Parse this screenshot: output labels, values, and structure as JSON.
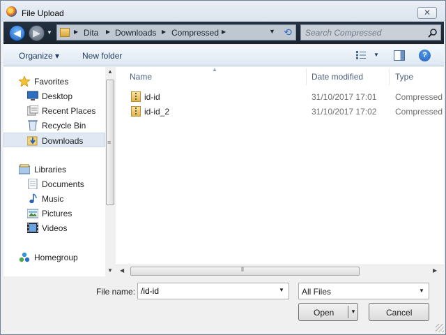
{
  "window": {
    "title": "File Upload",
    "close_glyph": "✕"
  },
  "address": {
    "back_glyph": "◀",
    "forward_glyph": "▶",
    "crumbs": [
      "Dita",
      "Downloads",
      "Compressed"
    ],
    "search_placeholder": "Search Compressed"
  },
  "toolbar": {
    "organize": "Organize ▾",
    "new_folder": "New folder",
    "help_glyph": "?"
  },
  "sidebar": {
    "items": [
      {
        "label": "Favorites",
        "icon": "star-icon"
      },
      {
        "label": "Desktop",
        "icon": "desktop-icon"
      },
      {
        "label": "Recent Places",
        "icon": "recent-places-icon"
      },
      {
        "label": "Recycle Bin",
        "icon": "recycle-bin-icon"
      },
      {
        "label": "Downloads",
        "icon": "downloads-folder-icon",
        "selected": true
      },
      {
        "label": "Libraries",
        "icon": "libraries-icon"
      },
      {
        "label": "Documents",
        "icon": "documents-icon"
      },
      {
        "label": "Music",
        "icon": "music-icon"
      },
      {
        "label": "Pictures",
        "icon": "pictures-icon"
      },
      {
        "label": "Videos",
        "icon": "videos-icon"
      },
      {
        "label": "Homegroup",
        "icon": "homegroup-icon"
      }
    ]
  },
  "files": {
    "columns": [
      "Name",
      "Date modified",
      "Type"
    ],
    "rows": [
      {
        "name": "id-id",
        "date": "31/10/2017 17:01",
        "type": "Compressed"
      },
      {
        "name": "id-id_2",
        "date": "31/10/2017 17:02",
        "type": "Compressed"
      }
    ]
  },
  "footer": {
    "file_name_label": "File name:",
    "file_name_value": "/id-id",
    "filter_value": "All Files",
    "open_label": "Open",
    "cancel_label": "Cancel"
  },
  "colors": {
    "accent": "#1e395b",
    "selection": "#dfe8f3",
    "address_bar": "#1a2430"
  }
}
